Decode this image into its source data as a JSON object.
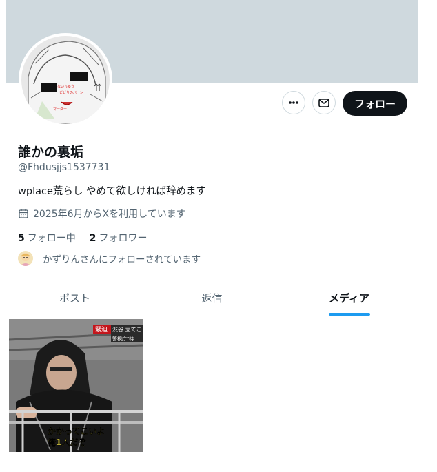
{
  "profile": {
    "name": "誰かの裏垢",
    "handle": "@Fhdusjjs1537731",
    "bio": "wplace荒らし やめて欲しければ辞めます",
    "joined": "2025年6月からXを利用しています",
    "following_count": "5",
    "following_label": "フォロー中",
    "followers_count": "2",
    "followers_label": "フォロワー",
    "followed_by": "かずりんさんにフォローされています"
  },
  "actions": {
    "follow_label": "フォロー",
    "more_icon": "more-icon",
    "message_icon": "mail-icon"
  },
  "tabs": [
    {
      "label": "ポスト",
      "active": false
    },
    {
      "label": "返信",
      "active": false
    },
    {
      "label": "メディア",
      "active": true
    }
  ],
  "media": {
    "caption_tag": "緊迫",
    "caption_top": "渋谷 立てこ",
    "caption_top2": "警視庁\"特",
    "subtitle_line1": "かかってこいよ",
    "subtitle_line2": "俺1人だぞ"
  },
  "colors": {
    "banner": "#cfd9de",
    "accent": "#1d9bf0",
    "follow_bg": "#0f1419"
  }
}
